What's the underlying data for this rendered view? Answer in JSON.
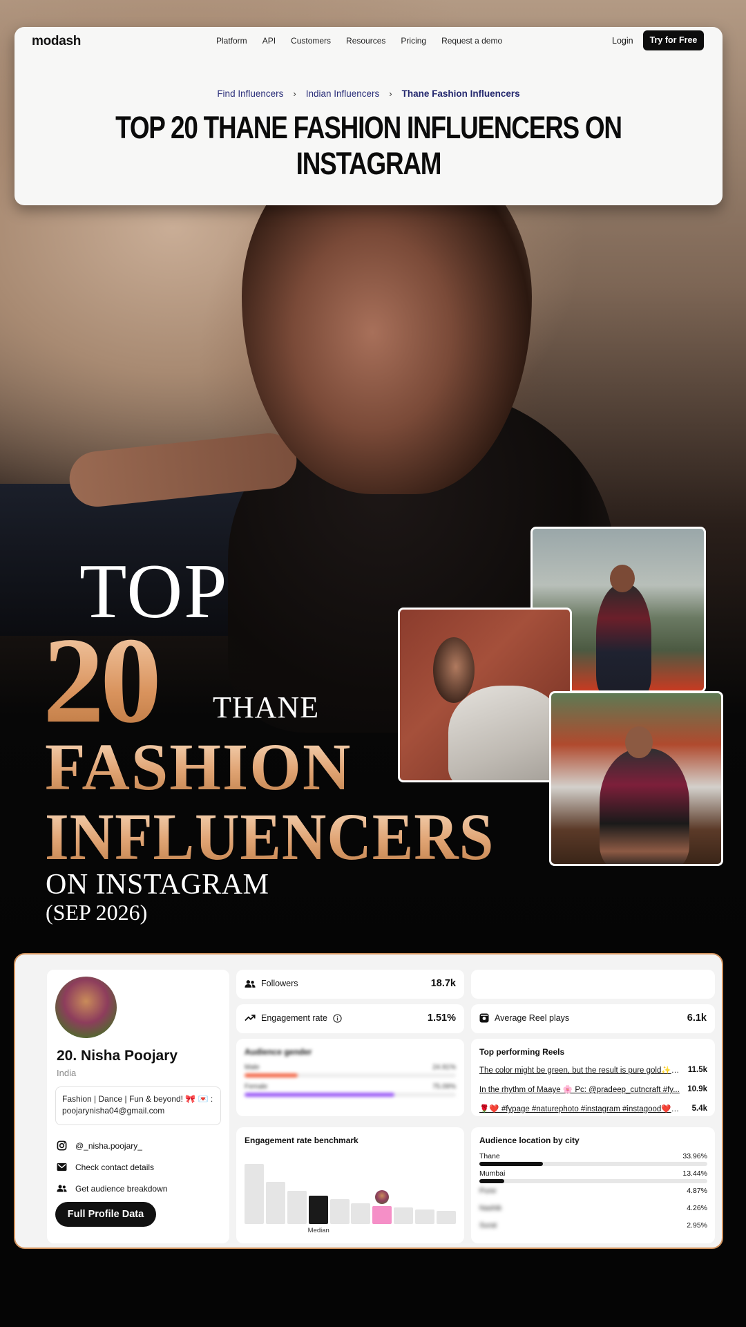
{
  "site": {
    "logo": "modash",
    "nav": [
      "Platform",
      "API",
      "Customers",
      "Resources",
      "Pricing",
      "Request a demo"
    ],
    "login": "Login",
    "cta": "Try for Free",
    "breadcrumb": [
      "Find Influencers",
      "Indian Influencers",
      "Thane Fashion Influencers"
    ],
    "breadcrumb_sep": "›",
    "title": "TOP 20 THANE FASHION INFLUENCERS ON INSTAGRAM"
  },
  "hero": {
    "top": "TOP",
    "number": "20",
    "city": "THANE",
    "line1": "FASHION",
    "line2": "INFLUENCERS",
    "platform": "ON INSTAGRAM",
    "date": "(SEP 2026)"
  },
  "profile": {
    "rank_name": "20. Nisha Poojary",
    "country": "India",
    "bio_line1": "Fashion | Dance | Fun & beyond! 🎀 💌 :",
    "bio_line2": "poojarynisha04@gmail.com",
    "handle": "@_nisha.poojary_",
    "contact": "Check contact details",
    "audience": "Get audience breakdown",
    "button": "Full Profile Data"
  },
  "stats": {
    "followers_label": "Followers",
    "followers": "18.7k",
    "engagement_label": "Engagement rate",
    "engagement": "1.51%",
    "reel_plays_label": "Average Reel plays",
    "reel_plays": "6.1k"
  },
  "audience_gender": {
    "title": "Audience gender",
    "rows": [
      {
        "label": "Male",
        "value": "24.91%",
        "fraction": 0.25,
        "color": "#f26a4b"
      },
      {
        "label": "Female",
        "value": "75.09%",
        "fraction": 0.71,
        "color": "#9b5cf6"
      }
    ]
  },
  "top_reels": {
    "title": "Top performing Reels",
    "rows": [
      {
        "text": "The color might be green, but the result is pure gold✨ ...",
        "value": "11.5k"
      },
      {
        "text": "In the rhythm of Maaye 🌸 Pc: @pradeep_cutncraft #fy...",
        "value": "10.9k"
      },
      {
        "text": "🌹❤️ #fypage #naturephoto #instagram #instagood❤️ ...",
        "value": "5.4k"
      }
    ]
  },
  "benchmark": {
    "title": "Engagement rate benchmark",
    "median_label": "Median",
    "bars": [
      0.92,
      0.64,
      0.5,
      0.43,
      0.38,
      0.32,
      0.27,
      0.25,
      0.22,
      0.2
    ],
    "median_index": 3,
    "profile_index": 6,
    "colors": {
      "default": "#e5e5e5",
      "median": "#1a1a1a",
      "profile": "#f58fc7"
    }
  },
  "location": {
    "title": "Audience location by city",
    "rows": [
      {
        "city": "Thane",
        "value": "33.96%",
        "fraction": 0.3396
      },
      {
        "city": "Mumbai",
        "value": "13.44%",
        "fraction": 0.1344
      },
      {
        "city": "Pune",
        "value": "4.87%",
        "fraction": 0.0487
      },
      {
        "city": "Nashik",
        "value": "4.26%",
        "fraction": 0.0426
      },
      {
        "city": "Surat",
        "value": "2.95%",
        "fraction": 0.0295
      }
    ]
  },
  "icons": {
    "followers": "people-icon",
    "engagement": "trend-up-icon",
    "info": "info-icon",
    "reel": "reel-icon",
    "instagram": "instagram-icon",
    "mail": "mail-icon",
    "audience": "people-icon"
  },
  "accent": "#d3945f"
}
